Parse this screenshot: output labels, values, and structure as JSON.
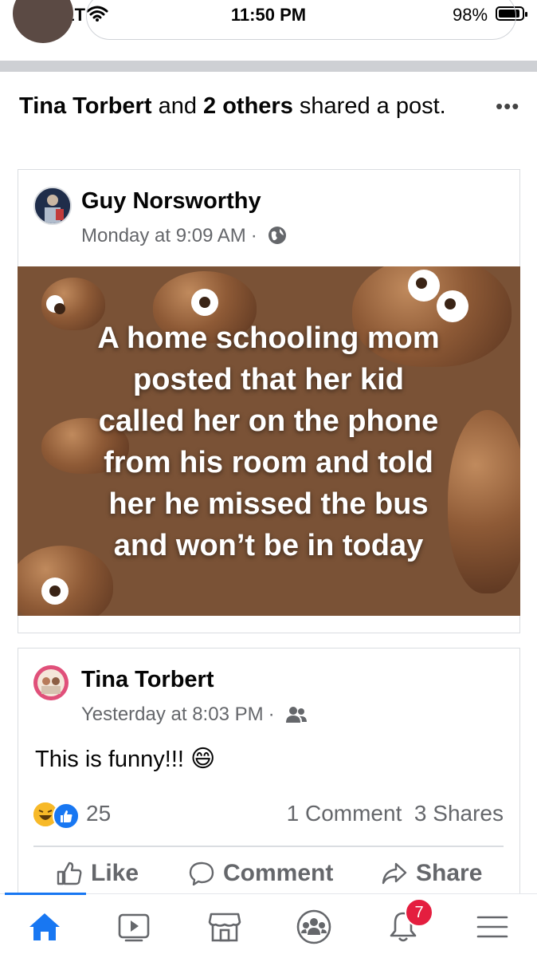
{
  "status_bar": {
    "carrier": "AT&T",
    "time": "11:50 PM",
    "battery_percent": "98%",
    "battery_level": 0.98
  },
  "share_header": {
    "name": "Tina Torbert",
    "connector": "and",
    "others": "2 others",
    "suffix": "shared a post."
  },
  "original_post": {
    "author": "Guy Norsworthy",
    "timestamp": "Monday at 9:09 AM",
    "audience_icon": "globe-icon",
    "image_text_lines": [
      "A home schooling mom",
      "posted that her kid",
      "called her on the phone",
      "from his room and told",
      "her he missed the bus",
      "and won’t be in today"
    ]
  },
  "share_post": {
    "author": "Tina Torbert",
    "timestamp": "Yesterday at 8:03 PM",
    "audience_icon": "friends-icon",
    "text": "This is funny!!!",
    "emoji": "😄",
    "reaction_count": "25",
    "comments": "1 Comment",
    "shares": "3 Shares"
  },
  "actions": {
    "like": "Like",
    "comment": "Comment",
    "share": "Share"
  },
  "bottom_nav": {
    "items": [
      "home-icon",
      "watch-icon",
      "marketplace-icon",
      "groups-icon",
      "notifications-icon",
      "menu-icon"
    ],
    "notifications_badge": "7"
  },
  "colors": {
    "accent": "#1877f2",
    "badge": "#e41e3f",
    "image_background": "#7a5236",
    "secondary_text": "#65676b"
  }
}
